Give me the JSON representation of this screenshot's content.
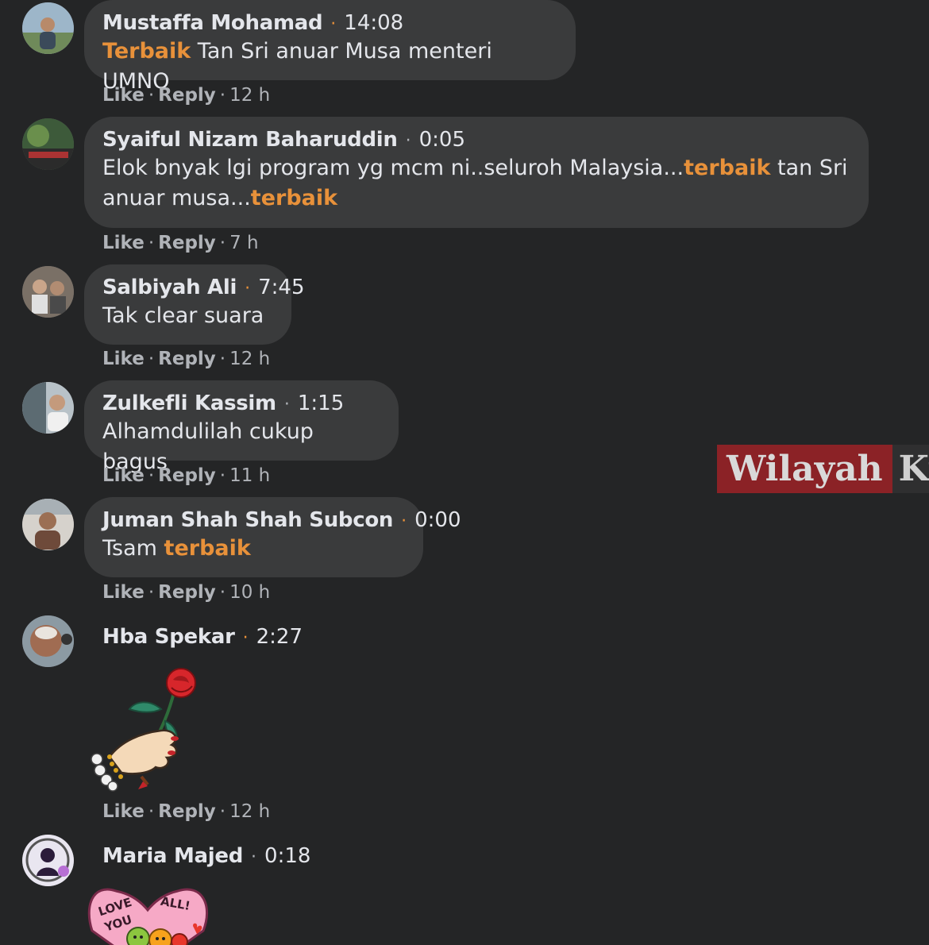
{
  "comments": [
    {
      "author": "Mustaffa Mohamad",
      "time": "14:08",
      "text_parts": [
        {
          "t": "Terbaik",
          "hl": true
        },
        {
          "t": " Tan Sri anuar Musa menteri UMNO",
          "hl": false
        }
      ],
      "like": "Like",
      "reply": "Reply",
      "age": "12 h"
    },
    {
      "author": "Syaiful Nizam Baharuddin",
      "time": "0:05",
      "text_parts": [
        {
          "t": "Elok bnyak lgi program yg mcm ni..seluroh Malaysia...",
          "hl": false
        },
        {
          "t": "terbaik",
          "hl": true
        },
        {
          "t": " tan Sri anuar musa...",
          "hl": false
        },
        {
          "t": "terbaik",
          "hl": true
        }
      ],
      "like": "Like",
      "reply": "Reply",
      "age": "7 h"
    },
    {
      "author": "Salbiyah Ali",
      "time": "7:45",
      "text_parts": [
        {
          "t": "Tak clear suara",
          "hl": false
        }
      ],
      "like": "Like",
      "reply": "Reply",
      "age": "12 h"
    },
    {
      "author": "Zulkefli Kassim",
      "time": "1:15",
      "text_parts": [
        {
          "t": "Alhamdulilah cukup bagus",
          "hl": false
        }
      ],
      "like": "Like",
      "reply": "Reply",
      "age": "11 h"
    },
    {
      "author": "Juman Shah Shah Subcon",
      "time": "0:00",
      "text_parts": [
        {
          "t": "Tsam ",
          "hl": false
        },
        {
          "t": "terbaik",
          "hl": true
        }
      ],
      "like": "Like",
      "reply": "Reply",
      "age": "10 h"
    },
    {
      "author": "Hba Spekar",
      "time": "2:27",
      "sticker": "hand-holding-rose-sticker",
      "like": "Like",
      "reply": "Reply",
      "age": "12 h"
    },
    {
      "author": "Maria Majed",
      "time": "0:18",
      "sticker": "love-you-all-heart-sticker",
      "sticker_text_1": "LOVE",
      "sticker_text_2": "YOU",
      "sticker_text_3": "ALL!"
    }
  ],
  "watermark": {
    "part1": "Wilayah",
    "part2": "Ku"
  },
  "colors": {
    "background": "#242526",
    "bubble": "#3a3b3c",
    "highlight": "#e8913a",
    "watermark_red": "#8b2226"
  }
}
